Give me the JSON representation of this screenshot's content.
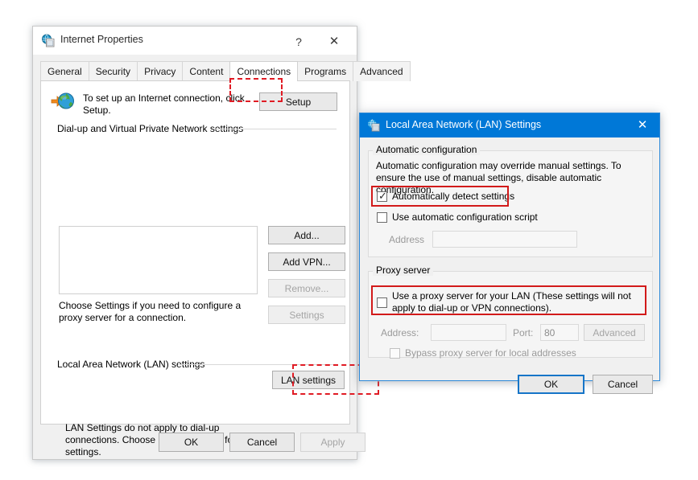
{
  "internet_properties": {
    "title": "Internet Properties",
    "title_icon": "internet-properties-icon",
    "help_button": "?",
    "close_button": "✕",
    "tabs": [
      {
        "label": "General",
        "selected": false
      },
      {
        "label": "Security",
        "selected": false
      },
      {
        "label": "Privacy",
        "selected": false
      },
      {
        "label": "Content",
        "selected": false
      },
      {
        "label": "Connections",
        "selected": true
      },
      {
        "label": "Programs",
        "selected": false
      },
      {
        "label": "Advanced",
        "selected": false
      }
    ],
    "setup_row": {
      "icon": "globe-with-arrow-icon",
      "text": "To set up an Internet connection, click Setup.",
      "button": "Setup"
    },
    "dialup_group": {
      "label": "Dial-up and Virtual Private Network settings",
      "list_value": "",
      "buttons": [
        {
          "label": "Add...",
          "disabled": false
        },
        {
          "label": "Add VPN...",
          "disabled": false
        },
        {
          "label": "Remove...",
          "disabled": true
        }
      ],
      "settings_button": {
        "label": "Settings",
        "disabled": true
      },
      "note": "Choose Settings if you need to configure a proxy server for a connection."
    },
    "lan_group": {
      "label": "Local Area Network (LAN) settings",
      "note": "LAN Settings do not apply to dial-up connections. Choose Settings above for dial-up settings.",
      "button": "LAN settings"
    },
    "footer_buttons": [
      {
        "label": "OK",
        "disabled": false
      },
      {
        "label": "Cancel",
        "disabled": false
      },
      {
        "label": "Apply",
        "disabled": true
      }
    ]
  },
  "lan_settings": {
    "title": "Local Area Network (LAN) Settings",
    "title_icon": "lan-settings-icon",
    "close_button": "✕",
    "automatic_configuration": {
      "label": "Automatic configuration",
      "description": "Automatic configuration may override manual settings.  To ensure the use of manual settings, disable automatic configuration.",
      "auto_detect": {
        "label": "Automatically detect settings",
        "checked": true
      },
      "use_script": {
        "label": "Use automatic configuration script",
        "checked": false
      },
      "address_label": "Address",
      "address_value": "",
      "address_disabled": true
    },
    "proxy_server": {
      "label": "Proxy server",
      "use_proxy": {
        "label": "Use a proxy server for your LAN (These settings will not apply to dial-up or VPN connections).",
        "checked": false
      },
      "address_label": "Address:",
      "address_value": "",
      "port_label": "Port:",
      "port_value": "80",
      "advanced_button": "Advanced",
      "bypass": {
        "label": "Bypass proxy server for local addresses",
        "checked": false
      }
    },
    "footer_buttons": [
      {
        "label": "OK",
        "default": true
      },
      {
        "label": "Cancel",
        "default": false
      }
    ]
  },
  "annotations": {
    "highlight_color": "#e01b24",
    "solid_highlight_color": "#d21a1a",
    "dashed_targets": [
      "connections-tab",
      "lan-settings-button"
    ],
    "solid_targets": [
      "automatically-detect-settings-checkbox",
      "use-a-proxy-server-checkbox"
    ]
  }
}
